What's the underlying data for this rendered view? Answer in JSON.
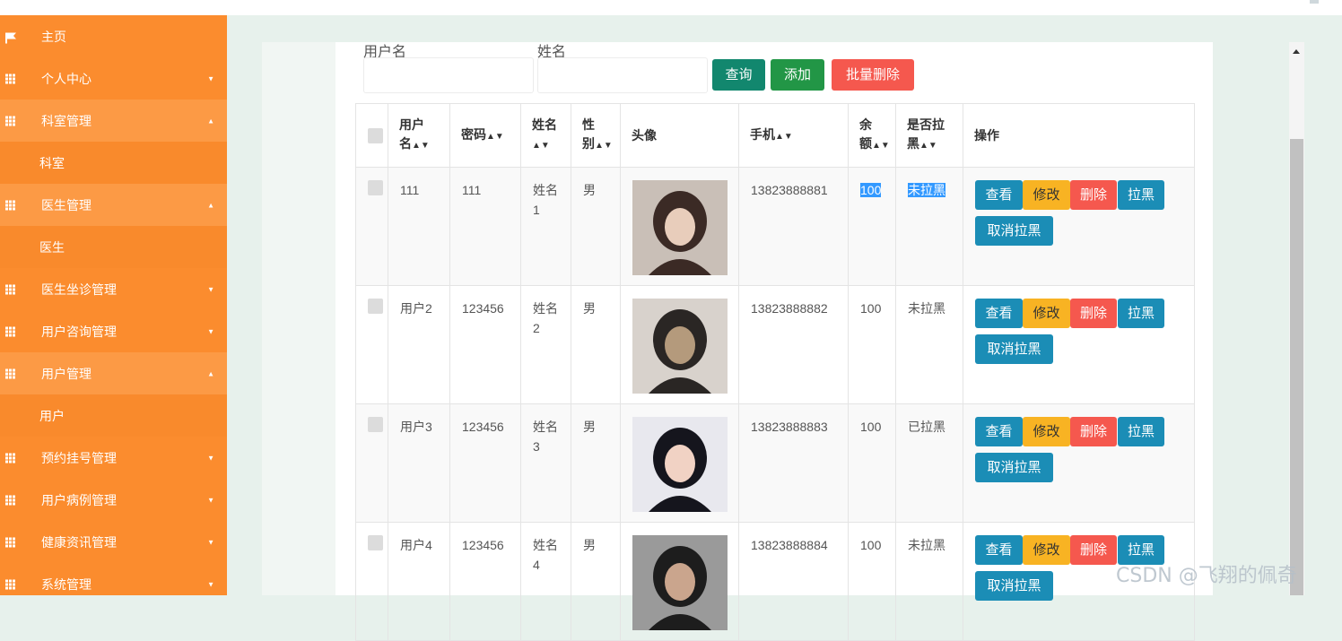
{
  "sidebar": {
    "items": [
      {
        "label": "主页",
        "icon": "flag-icon",
        "arrow": ""
      },
      {
        "label": "个人中心",
        "icon": "grid-icon",
        "arrow": "▼"
      },
      {
        "label": "科室管理",
        "icon": "grid-icon",
        "arrow": "▲",
        "open": true
      },
      {
        "label": "科室",
        "sub": true
      },
      {
        "label": "医生管理",
        "icon": "grid-icon",
        "arrow": "▲",
        "open": true
      },
      {
        "label": "医生",
        "sub": true
      },
      {
        "label": "医生坐诊管理",
        "icon": "grid-icon",
        "arrow": "▼"
      },
      {
        "label": "用户咨询管理",
        "icon": "grid-icon",
        "arrow": "▼"
      },
      {
        "label": "用户管理",
        "icon": "grid-icon",
        "arrow": "▲",
        "open": true
      },
      {
        "label": "用户",
        "sub": true
      },
      {
        "label": "预约挂号管理",
        "icon": "grid-icon",
        "arrow": "▼"
      },
      {
        "label": "用户病例管理",
        "icon": "grid-icon",
        "arrow": "▼"
      },
      {
        "label": "健康资讯管理",
        "icon": "grid-icon",
        "arrow": "▼"
      },
      {
        "label": "系统管理",
        "icon": "grid-icon",
        "arrow": "▼"
      }
    ]
  },
  "search": {
    "username_label": "用户名",
    "name_label": "姓名",
    "username_value": "",
    "name_value": "",
    "query_btn": "查询",
    "add_btn": "添加",
    "batch_delete_btn": "批量删除"
  },
  "table": {
    "headers": [
      "用户名",
      "密码",
      "姓名",
      "性别",
      "头像",
      "手机",
      "余额",
      "是否拉黑",
      "操作"
    ],
    "header_display": [
      "用户\n名",
      "密码",
      "姓名\n",
      "性\n别",
      "头像",
      "手机",
      "余\n额",
      "是否拉\n黑",
      "操作"
    ],
    "rows": [
      {
        "username": "111",
        "password": "111",
        "name": "姓名1",
        "gender": "男",
        "phone": "13823888881",
        "balance": "100",
        "blacklist": "未拉黑",
        "avatar_colors": [
          "#c9bfb7",
          "#3b2a25",
          "#e8cdbb"
        ]
      },
      {
        "username": "用户2",
        "password": "123456",
        "name": "姓名2",
        "gender": "男",
        "phone": "13823888882",
        "balance": "100",
        "blacklist": "未拉黑",
        "avatar_colors": [
          "#d8d2cc",
          "#2a2624",
          "#b49a7c"
        ]
      },
      {
        "username": "用户3",
        "password": "123456",
        "name": "姓名3",
        "gender": "男",
        "phone": "13823888883",
        "balance": "100",
        "blacklist": "已拉黑",
        "avatar_colors": [
          "#e8e8ee",
          "#15151d",
          "#f1d2c4"
        ]
      },
      {
        "username": "用户4",
        "password": "123456",
        "name": "姓名4",
        "gender": "男",
        "phone": "13823888884",
        "balance": "100",
        "blacklist": "未拉黑",
        "avatar_colors": [
          "#9a9a9a",
          "#1d1d1d",
          "#caa58d"
        ]
      }
    ],
    "ops": {
      "view": "查看",
      "edit": "修改",
      "delete": "删除",
      "blacklist": "拉黑",
      "unblacklist": "取消拉黑"
    }
  },
  "watermark": "CSDN @飞翔的佩奇"
}
